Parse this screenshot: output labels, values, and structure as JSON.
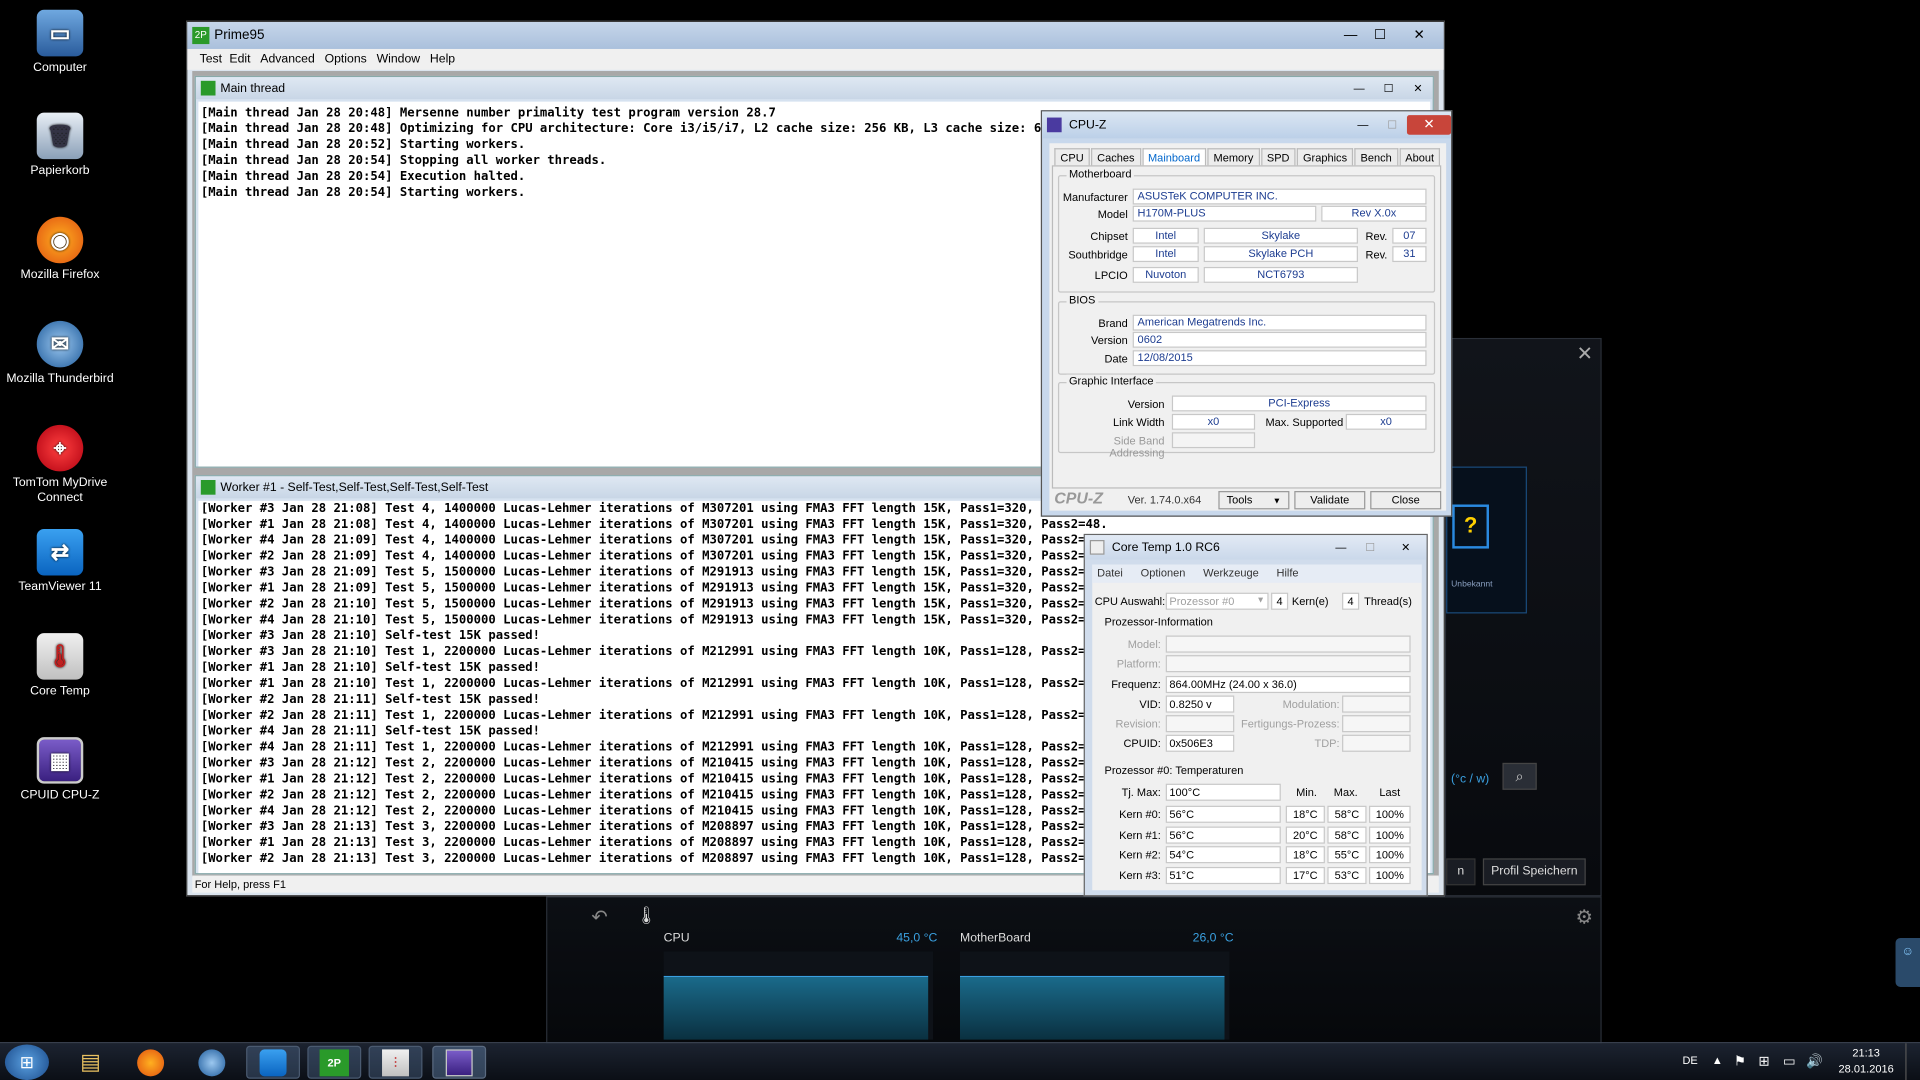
{
  "desktop": {
    "icons": [
      {
        "label": "Computer",
        "icon": "computer-icon"
      },
      {
        "label": "Papierkorb",
        "icon": "recycle-bin-icon"
      },
      {
        "label": "Mozilla Firefox",
        "icon": "firefox-icon"
      },
      {
        "label": "Mozilla Thunderbird",
        "icon": "thunderbird-icon"
      },
      {
        "label": "TomTom MyDrive Connect",
        "icon": "tomtom-icon"
      },
      {
        "label": "TeamViewer 11",
        "icon": "teamviewer-icon"
      },
      {
        "label": "Core Temp",
        "icon": "coretemp-icon"
      },
      {
        "label": "CPUID CPU-Z",
        "icon": "cpuz-icon"
      }
    ]
  },
  "prime95": {
    "title": "Prime95",
    "menu": [
      "Test",
      "Edit",
      "Advanced",
      "Options",
      "Window",
      "Help"
    ],
    "main_thread": {
      "title": "Main thread",
      "lines": [
        "[Main thread Jan 28 20:48] Mersenne number primality test program version 28.7",
        "[Main thread Jan 28 20:48] Optimizing for CPU architecture: Core i3/i5/i7, L2 cache size: 256 KB, L3 cache size: 6 MB",
        "[Main thread Jan 28 20:52] Starting workers.",
        "[Main thread Jan 28 20:54] Stopping all worker threads.",
        "[Main thread Jan 28 20:54] Execution halted.",
        "[Main thread Jan 28 20:54] Starting workers."
      ]
    },
    "worker": {
      "title": "Worker #1 - Self-Test,Self-Test,Self-Test,Self-Test",
      "lines": [
        "[Worker #3 Jan 28 21:08] Test 4, 1400000 Lucas-Lehmer iterations of M307201 using FMA3 FFT length 15K, Pass1=320, Pass2=48.",
        "[Worker #1 Jan 28 21:08] Test 4, 1400000 Lucas-Lehmer iterations of M307201 using FMA3 FFT length 15K, Pass1=320, Pass2=48.",
        "[Worker #4 Jan 28 21:09] Test 4, 1400000 Lucas-Lehmer iterations of M307201 using FMA3 FFT length 15K, Pass1=320, Pass2=48.",
        "[Worker #2 Jan 28 21:09] Test 4, 1400000 Lucas-Lehmer iterations of M307201 using FMA3 FFT length 15K, Pass1=320, Pass2=48.",
        "[Worker #3 Jan 28 21:09] Test 5, 1500000 Lucas-Lehmer iterations of M291913 using FMA3 FFT length 15K, Pass1=320, Pass2=48.",
        "[Worker #1 Jan 28 21:09] Test 5, 1500000 Lucas-Lehmer iterations of M291913 using FMA3 FFT length 15K, Pass1=320, Pass2=48.",
        "[Worker #2 Jan 28 21:10] Test 5, 1500000 Lucas-Lehmer iterations of M291913 using FMA3 FFT length 15K, Pass1=320, Pass2=48.",
        "[Worker #4 Jan 28 21:10] Test 5, 1500000 Lucas-Lehmer iterations of M291913 using FMA3 FFT length 15K, Pass1=320, Pass2=48.",
        "[Worker #3 Jan 28 21:10] Self-test 15K passed!",
        "[Worker #3 Jan 28 21:10] Test 1, 2200000 Lucas-Lehmer iterations of M212991 using FMA3 FFT length 10K, Pass1=128, Pass2=80.",
        "[Worker #1 Jan 28 21:10] Self-test 15K passed!",
        "[Worker #1 Jan 28 21:10] Test 1, 2200000 Lucas-Lehmer iterations of M212991 using FMA3 FFT length 10K, Pass1=128, Pass2=80.",
        "[Worker #2 Jan 28 21:11] Self-test 15K passed!",
        "[Worker #2 Jan 28 21:11] Test 1, 2200000 Lucas-Lehmer iterations of M212991 using FMA3 FFT length 10K, Pass1=128, Pass2=80.",
        "[Worker #4 Jan 28 21:11] Self-test 15K passed!",
        "[Worker #4 Jan 28 21:11] Test 1, 2200000 Lucas-Lehmer iterations of M212991 using FMA3 FFT length 10K, Pass1=128, Pass2=80.",
        "[Worker #3 Jan 28 21:12] Test 2, 2200000 Lucas-Lehmer iterations of M210415 using FMA3 FFT length 10K, Pass1=128, Pass2=80.",
        "[Worker #1 Jan 28 21:12] Test 2, 2200000 Lucas-Lehmer iterations of M210415 using FMA3 FFT length 10K, Pass1=128, Pass2=80.",
        "[Worker #2 Jan 28 21:12] Test 2, 2200000 Lucas-Lehmer iterations of M210415 using FMA3 FFT length 10K, Pass1=128, Pass2=80.",
        "[Worker #4 Jan 28 21:12] Test 2, 2200000 Lucas-Lehmer iterations of M210415 using FMA3 FFT length 10K, Pass1=128, Pass2=80.",
        "[Worker #3 Jan 28 21:13] Test 3, 2200000 Lucas-Lehmer iterations of M208897 using FMA3 FFT length 10K, Pass1=128, Pass2=80.",
        "[Worker #1 Jan 28 21:13] Test 3, 2200000 Lucas-Lehmer iterations of M208897 using FMA3 FFT length 10K, Pass1=128, Pass2=80.",
        "[Worker #2 Jan 28 21:13] Test 3, 2200000 Lucas-Lehmer iterations of M208897 using FMA3 FFT length 10K, Pass1=128, Pass2=80."
      ]
    },
    "status": "For Help, press F1"
  },
  "cpuz": {
    "title": "CPU-Z",
    "tabs": [
      "CPU",
      "Caches",
      "Mainboard",
      "Memory",
      "SPD",
      "Graphics",
      "Bench",
      "About"
    ],
    "active_tab": "Mainboard",
    "motherboard": {
      "group": "Motherboard",
      "manufacturer_label": "Manufacturer",
      "manufacturer": "ASUSTeK COMPUTER INC.",
      "model_label": "Model",
      "model": "H170M-PLUS",
      "model_rev": "Rev X.0x",
      "chipset_label": "Chipset",
      "chipset_vendor": "Intel",
      "chipset_name": "Skylake",
      "rev_label": "Rev.",
      "chipset_rev": "07",
      "southbridge_label": "Southbridge",
      "sb_vendor": "Intel",
      "sb_name": "Skylake PCH",
      "sb_rev": "31",
      "lpcio_label": "LPCIO",
      "lpcio_vendor": "Nuvoton",
      "lpcio_name": "NCT6793"
    },
    "bios": {
      "group": "BIOS",
      "brand_label": "Brand",
      "brand": "American Megatrends Inc.",
      "version_label": "Version",
      "version": "0602",
      "date_label": "Date",
      "date": "12/08/2015"
    },
    "graphic": {
      "group": "Graphic Interface",
      "version_label": "Version",
      "version": "PCI-Express",
      "link_label": "Link Width",
      "link": "x0",
      "max_label": "Max. Supported",
      "max": "x0",
      "sba_label": "Side Band Addressing"
    },
    "footer": {
      "logo": "CPU-Z",
      "version": "Ver. 1.74.0.x64",
      "tools": "Tools",
      "validate": "Validate",
      "close": "Close"
    }
  },
  "coretemp": {
    "title": "Core Temp 1.0 RC6",
    "menu": [
      "Datei",
      "Optionen",
      "Werkzeuge",
      "Hilfe"
    ],
    "cpu_select_label": "CPU Auswahl:",
    "cpu_select": "Prozessor #0",
    "cores": "4",
    "cores_label": "Kern(e)",
    "threads": "4",
    "threads_label": "Thread(s)",
    "info_group": "Prozessor-Information",
    "model_label": "Model:",
    "platform_label": "Platform:",
    "freq_label": "Frequenz:",
    "freq": "864.00MHz (24.00 x 36.0)",
    "vid_label": "VID:",
    "vid": "0.8250 v",
    "modulation_label": "Modulation:",
    "revision_label": "Revision:",
    "process_label": "Fertigungs-Prozess:",
    "cpuid_label": "CPUID:",
    "cpuid": "0x506E3",
    "tdp_label": "TDP:",
    "temps_group": "Prozessor #0: Temperaturen",
    "tjmax_label": "Tj. Max:",
    "tjmax": "100°C",
    "col_min": "Min.",
    "col_max": "Max.",
    "col_last": "Last",
    "cores_rows": [
      {
        "label": "Kern #0:",
        "temp": "56°C",
        "min": "18°C",
        "max": "58°C",
        "load": "100%"
      },
      {
        "label": "Kern #1:",
        "temp": "56°C",
        "min": "20°C",
        "max": "58°C",
        "load": "100%"
      },
      {
        "label": "Kern #2:",
        "temp": "54°C",
        "min": "18°C",
        "max": "55°C",
        "load": "100%"
      },
      {
        "label": "Kern #3:",
        "temp": "51°C",
        "min": "17°C",
        "max": "53°C",
        "load": "100%"
      }
    ]
  },
  "asus": {
    "unknown": "Unbekannt",
    "unit": "(°c / w)",
    "save_profile": "Profil Speichern",
    "partial_button": "n",
    "cpu_label": "CPU",
    "cpu_temp": "45,0 °C",
    "mb_label": "MotherBoard",
    "mb_temp": "26,0 °C"
  },
  "taskbar": {
    "lang": "DE",
    "time": "21:13",
    "date": "28.01.2016"
  }
}
